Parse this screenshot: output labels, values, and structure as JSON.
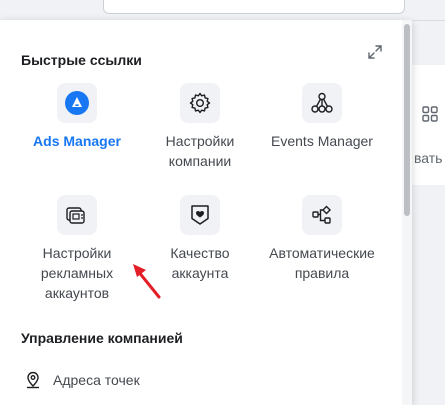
{
  "colors": {
    "accent": "#1877f2",
    "arrow": "#e41e26",
    "tile_bg": "#f0f2f5"
  },
  "background": {
    "partial_text": "вать"
  },
  "quick_links": {
    "title": "Быстрые ссылки",
    "expand_icon": "expand-icon",
    "items": [
      {
        "label": "Ads Manager",
        "icon": "ads-manager-icon",
        "active": true
      },
      {
        "label": "Настройки\nкомпании",
        "icon": "gear-icon"
      },
      {
        "label": "Events Manager",
        "icon": "events-manager-icon"
      },
      {
        "label": "Настройки\nрекламных\nаккаунтов",
        "icon": "ad-accounts-icon"
      },
      {
        "label": "Качество\nаккаунта",
        "icon": "shield-icon"
      },
      {
        "label": "Автоматические\nправила",
        "icon": "automated-rules-icon"
      }
    ]
  },
  "business_management": {
    "title": "Управление компанией",
    "items": [
      {
        "label": "Адреса точек",
        "icon": "location-pin-icon"
      }
    ]
  }
}
